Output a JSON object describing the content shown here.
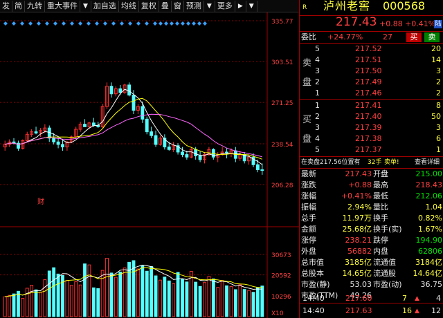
{
  "toolbar": {
    "items": [
      "发",
      "简",
      "九转",
      "重大事件",
      "▼",
      "加自选",
      "均线",
      "复权",
      "叠",
      "窗",
      "预测",
      "▼",
      "更多",
      "▶",
      "▼"
    ]
  },
  "chart": {
    "price_labels": [
      "335.77",
      "303.51",
      "271.25",
      "238.54",
      "206.28"
    ],
    "volume_labels": [
      "30673",
      "20592",
      "10296",
      "X10"
    ],
    "finance_marker": "财",
    "colors": {
      "up": "#ff3030",
      "down": "#54ffff",
      "ma5": "#ffffff",
      "ma10": "#ffff00",
      "ma20": "#ff66ff"
    }
  },
  "chart_data": {
    "type": "candlestick",
    "price_axis": [
      206.28,
      238.54,
      271.25,
      303.51,
      335.77
    ],
    "volume_axis": [
      10296,
      20592,
      30673
    ],
    "ohlc": [
      [
        236,
        241,
        233,
        238
      ],
      [
        238,
        242,
        236,
        240
      ],
      [
        240,
        243,
        238,
        239
      ],
      [
        239,
        241,
        233,
        235
      ],
      [
        235,
        242,
        234,
        241
      ],
      [
        241,
        248,
        240,
        246
      ],
      [
        246,
        250,
        244,
        248
      ],
      [
        248,
        252,
        246,
        247
      ],
      [
        247,
        251,
        244,
        249
      ],
      [
        249,
        254,
        247,
        251
      ],
      [
        251,
        253,
        240,
        243
      ],
      [
        243,
        247,
        238,
        240
      ],
      [
        240,
        244,
        235,
        238
      ],
      [
        238,
        242,
        233,
        236
      ],
      [
        236,
        241,
        233,
        240
      ],
      [
        240,
        245,
        239,
        244
      ],
      [
        244,
        252,
        243,
        250
      ],
      [
        250,
        256,
        248,
        254
      ],
      [
        254,
        258,
        252,
        252
      ],
      [
        252,
        256,
        250,
        255
      ],
      [
        255,
        259,
        252,
        253
      ],
      [
        253,
        256,
        251,
        252
      ],
      [
        252,
        270,
        251,
        268
      ],
      [
        268,
        287,
        266,
        284
      ],
      [
        284,
        287,
        275,
        278
      ],
      [
        278,
        284,
        276,
        282
      ],
      [
        282,
        285,
        277,
        279
      ],
      [
        279,
        286,
        278,
        285
      ],
      [
        285,
        287,
        276,
        277
      ],
      [
        277,
        281,
        262,
        265
      ],
      [
        265,
        270,
        262,
        268
      ],
      [
        268,
        272,
        255,
        258
      ],
      [
        258,
        260,
        246,
        248
      ],
      [
        248,
        252,
        243,
        245
      ],
      [
        245,
        249,
        236,
        238
      ],
      [
        238,
        245,
        237,
        243
      ],
      [
        243,
        246,
        234,
        236
      ],
      [
        236,
        240,
        233,
        234
      ],
      [
        234,
        240,
        232,
        237
      ],
      [
        237,
        239,
        230,
        232
      ],
      [
        232,
        236,
        228,
        230
      ],
      [
        230,
        233,
        226,
        228
      ],
      [
        228,
        236,
        227,
        234
      ],
      [
        234,
        236,
        226,
        229
      ],
      [
        229,
        233,
        224,
        226
      ],
      [
        226,
        232,
        223,
        230
      ],
      [
        230,
        236,
        229,
        234
      ],
      [
        234,
        235,
        226,
        228
      ],
      [
        228,
        232,
        224,
        230
      ],
      [
        230,
        236,
        229,
        232
      ],
      [
        232,
        235,
        227,
        231
      ],
      [
        231,
        235,
        228,
        233
      ],
      [
        233,
        236,
        224,
        227
      ],
      [
        227,
        233,
        225,
        230
      ],
      [
        230,
        232,
        223,
        225
      ],
      [
        225,
        230,
        222,
        228
      ],
      [
        228,
        231,
        220,
        222
      ],
      [
        222,
        226,
        216,
        218
      ],
      [
        218,
        223,
        214,
        217.43
      ]
    ],
    "volume": [
      9800,
      10500,
      11200,
      12500,
      9000,
      14000,
      15500,
      13200,
      12000,
      18200,
      22500,
      24100,
      21000,
      20300,
      17800,
      15400,
      17200,
      15600,
      26000,
      25500,
      14200,
      13800,
      22800,
      28800,
      21500,
      19400,
      22000,
      24000,
      26800,
      27600,
      23500,
      25100,
      22400,
      24700,
      20100,
      18000,
      19500,
      17600,
      16200,
      21800,
      18400,
      17100,
      22300,
      17000,
      14900,
      16800,
      19800,
      18600,
      14400,
      17800,
      15200,
      14800,
      13300,
      15700,
      13400,
      12900,
      12000,
      14200,
      15100
    ]
  },
  "panel": {
    "r_mark": "R",
    "stock_name": "泸州老窖",
    "stock_code": "000568",
    "last_price": "217.43",
    "change": "+0.88",
    "change_pct": "+0.41%",
    "tag_lu": "陆",
    "weibi_label": "委比",
    "weibi_value": "+24.77%",
    "weicha_value": "27",
    "buy_btn": "买",
    "sell_btn": "卖",
    "sell_side_label": [
      "卖",
      "盘"
    ],
    "buy_side_label": [
      "买",
      "盘"
    ],
    "asks": [
      {
        "level": "5",
        "price": "217.52",
        "vol": "20"
      },
      {
        "level": "4",
        "price": "217.51",
        "vol": "14"
      },
      {
        "level": "3",
        "price": "217.50",
        "vol": "3"
      },
      {
        "level": "2",
        "price": "217.49",
        "vol": "2"
      },
      {
        "level": "1",
        "price": "217.46",
        "vol": "2"
      }
    ],
    "bids": [
      {
        "level": "1",
        "price": "217.41",
        "vol": "8"
      },
      {
        "level": "2",
        "price": "217.40",
        "vol": "50"
      },
      {
        "level": "3",
        "price": "217.39",
        "vol": "3"
      },
      {
        "level": "4",
        "price": "217.38",
        "vol": "6"
      },
      {
        "level": "5",
        "price": "217.37",
        "vol": "1"
      }
    ],
    "order_note": "在卖盘217.56位置有",
    "order_note_qty": "32手",
    "order_note_tail": "卖单!",
    "detail_link": "查看详细",
    "stats": [
      {
        "l1": "最新",
        "v1": "217.43",
        "c1": "red",
        "l2": "开盘",
        "v2": "215.00",
        "c2": "green"
      },
      {
        "l1": "涨跌",
        "v1": "+0.88",
        "c1": "red",
        "l2": "最高",
        "v2": "218.43",
        "c2": "red"
      },
      {
        "l1": "涨幅",
        "v1": "+0.41%",
        "c1": "red",
        "l2": "最低",
        "v2": "212.06",
        "c2": "green"
      },
      {
        "l1": "振幅",
        "v1": "2.94%",
        "c1": "yellow",
        "l2": "量比",
        "v2": "1.04",
        "c2": "yellow"
      },
      {
        "l1": "总手",
        "v1": "11.97万",
        "c1": "yellow",
        "l2": "换手",
        "v2": "0.82%",
        "c2": "yellow"
      },
      {
        "l1": "金额",
        "v1": "25.68亿",
        "c1": "yellow",
        "l2": "换手(实)",
        "v2": "1.67%",
        "c2": "yellow"
      },
      {
        "l1": "涨停",
        "v1": "238.21",
        "c1": "red",
        "l2": "跌停",
        "v2": "194.90",
        "c2": "green"
      },
      {
        "l1": "外盘",
        "v1": "56882",
        "c1": "red",
        "l2": "内盘",
        "v2": "62806",
        "c2": "green"
      },
      {
        "l1": "总市值",
        "v1": "3185亿",
        "c1": "yellow",
        "l2": "流通值",
        "v2": "3184亿",
        "c2": "yellow"
      },
      {
        "l1": "总股本",
        "v1": "14.65亿",
        "c1": "yellow",
        "l2": "流通股",
        "v2": "14.64亿",
        "c2": "yellow"
      },
      {
        "l1": "市盈(静)",
        "v1": "53.03",
        "c1": "white",
        "l2": "市盈(动)",
        "v2": "36.75",
        "c2": "white"
      },
      {
        "l1": "市盈(TTM)",
        "v1": "49.26",
        "c1": "white",
        "l2": "",
        "v2": "",
        "c2": "white"
      }
    ],
    "ticks": [
      {
        "time": "14:40",
        "price": "217.60",
        "vol": "7",
        "dir": "▲",
        "count": "4"
      },
      {
        "time": "14:40",
        "price": "217.63",
        "vol": "16",
        "dir": "▲",
        "count": "12"
      }
    ]
  }
}
